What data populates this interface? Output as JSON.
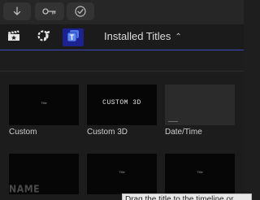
{
  "toolbar": {
    "buttons": [
      {
        "name": "download-icon"
      },
      {
        "name": "key-icon"
      },
      {
        "name": "checkmark-circle-icon"
      }
    ]
  },
  "browser": {
    "icons": [
      "clapper-icon",
      "photos-music-icon",
      "titles-icon"
    ],
    "active_icon": "titles-icon",
    "title": "Installed Titles",
    "title_chevron": "⌃⌄",
    "accent": "#3c4cc4",
    "active_bg": "#1c2290"
  },
  "titles": [
    {
      "label": "Custom",
      "thumb_text": "Title"
    },
    {
      "label": "Custom 3D",
      "thumb_text": "CUSTOM 3D"
    },
    {
      "label": "Date/Time",
      "thumb_text": ""
    },
    {
      "label": "",
      "thumb_text": "NAME"
    },
    {
      "label": "",
      "thumb_text": "Title"
    },
    {
      "label": "",
      "thumb_text": "Title"
    }
  ],
  "tooltip": {
    "text": "Drag the title to the timeline or"
  }
}
